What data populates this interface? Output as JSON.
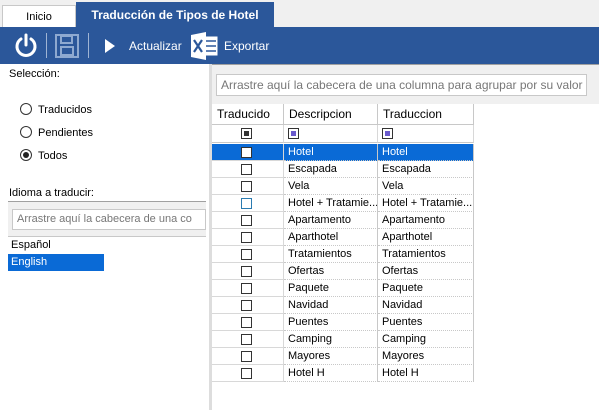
{
  "tabs": [
    "Inicio",
    "Traducción de Tipos de Hotel"
  ],
  "toolbar": {
    "refresh_label": "Actualizar",
    "export_label": "Exportar"
  },
  "colors": {
    "accent": "#2b579a",
    "selection": "#0a6ad6"
  },
  "selection": {
    "title": "Selección:",
    "options": [
      "Traducidos",
      "Pendientes",
      "Todos"
    ],
    "selected": "Todos"
  },
  "language": {
    "title": "Idioma a traducir:",
    "group_placeholder": "Arrastre aquí la cabecera de una co",
    "items": [
      "Español",
      "English"
    ],
    "selected": "English"
  },
  "grid": {
    "group_placeholder": "Arrastre aquí la cabecera de una columna para agrupar por su valor",
    "columns": [
      "Traducido",
      "Descripcion",
      "Traduccion"
    ],
    "rows": [
      {
        "traducido": false,
        "descripcion": "Hotel",
        "traduccion": "Hotel"
      },
      {
        "traducido": false,
        "descripcion": "Escapada",
        "traduccion": "Escapada"
      },
      {
        "traducido": false,
        "descripcion": "Vela",
        "traduccion": "Vela"
      },
      {
        "traducido": false,
        "descripcion": "Hotel + Tratamie...",
        "traduccion": "Hotel + Tratamie..."
      },
      {
        "traducido": false,
        "descripcion": "Apartamento",
        "traduccion": "Apartamento"
      },
      {
        "traducido": false,
        "descripcion": "Aparthotel",
        "traduccion": "Aparthotel"
      },
      {
        "traducido": false,
        "descripcion": "Tratamientos",
        "traduccion": "Tratamientos"
      },
      {
        "traducido": false,
        "descripcion": "Ofertas",
        "traduccion": "Ofertas"
      },
      {
        "traducido": false,
        "descripcion": "Paquete",
        "traduccion": "Paquete"
      },
      {
        "traducido": false,
        "descripcion": "Navidad",
        "traduccion": "Navidad"
      },
      {
        "traducido": false,
        "descripcion": "Puentes",
        "traduccion": "Puentes"
      },
      {
        "traducido": false,
        "descripcion": "Camping",
        "traduccion": "Camping"
      },
      {
        "traducido": false,
        "descripcion": "Mayores",
        "traduccion": "Mayores"
      },
      {
        "traducido": false,
        "descripcion": "Hotel H",
        "traduccion": "Hotel H"
      }
    ],
    "selected_row": 0
  }
}
